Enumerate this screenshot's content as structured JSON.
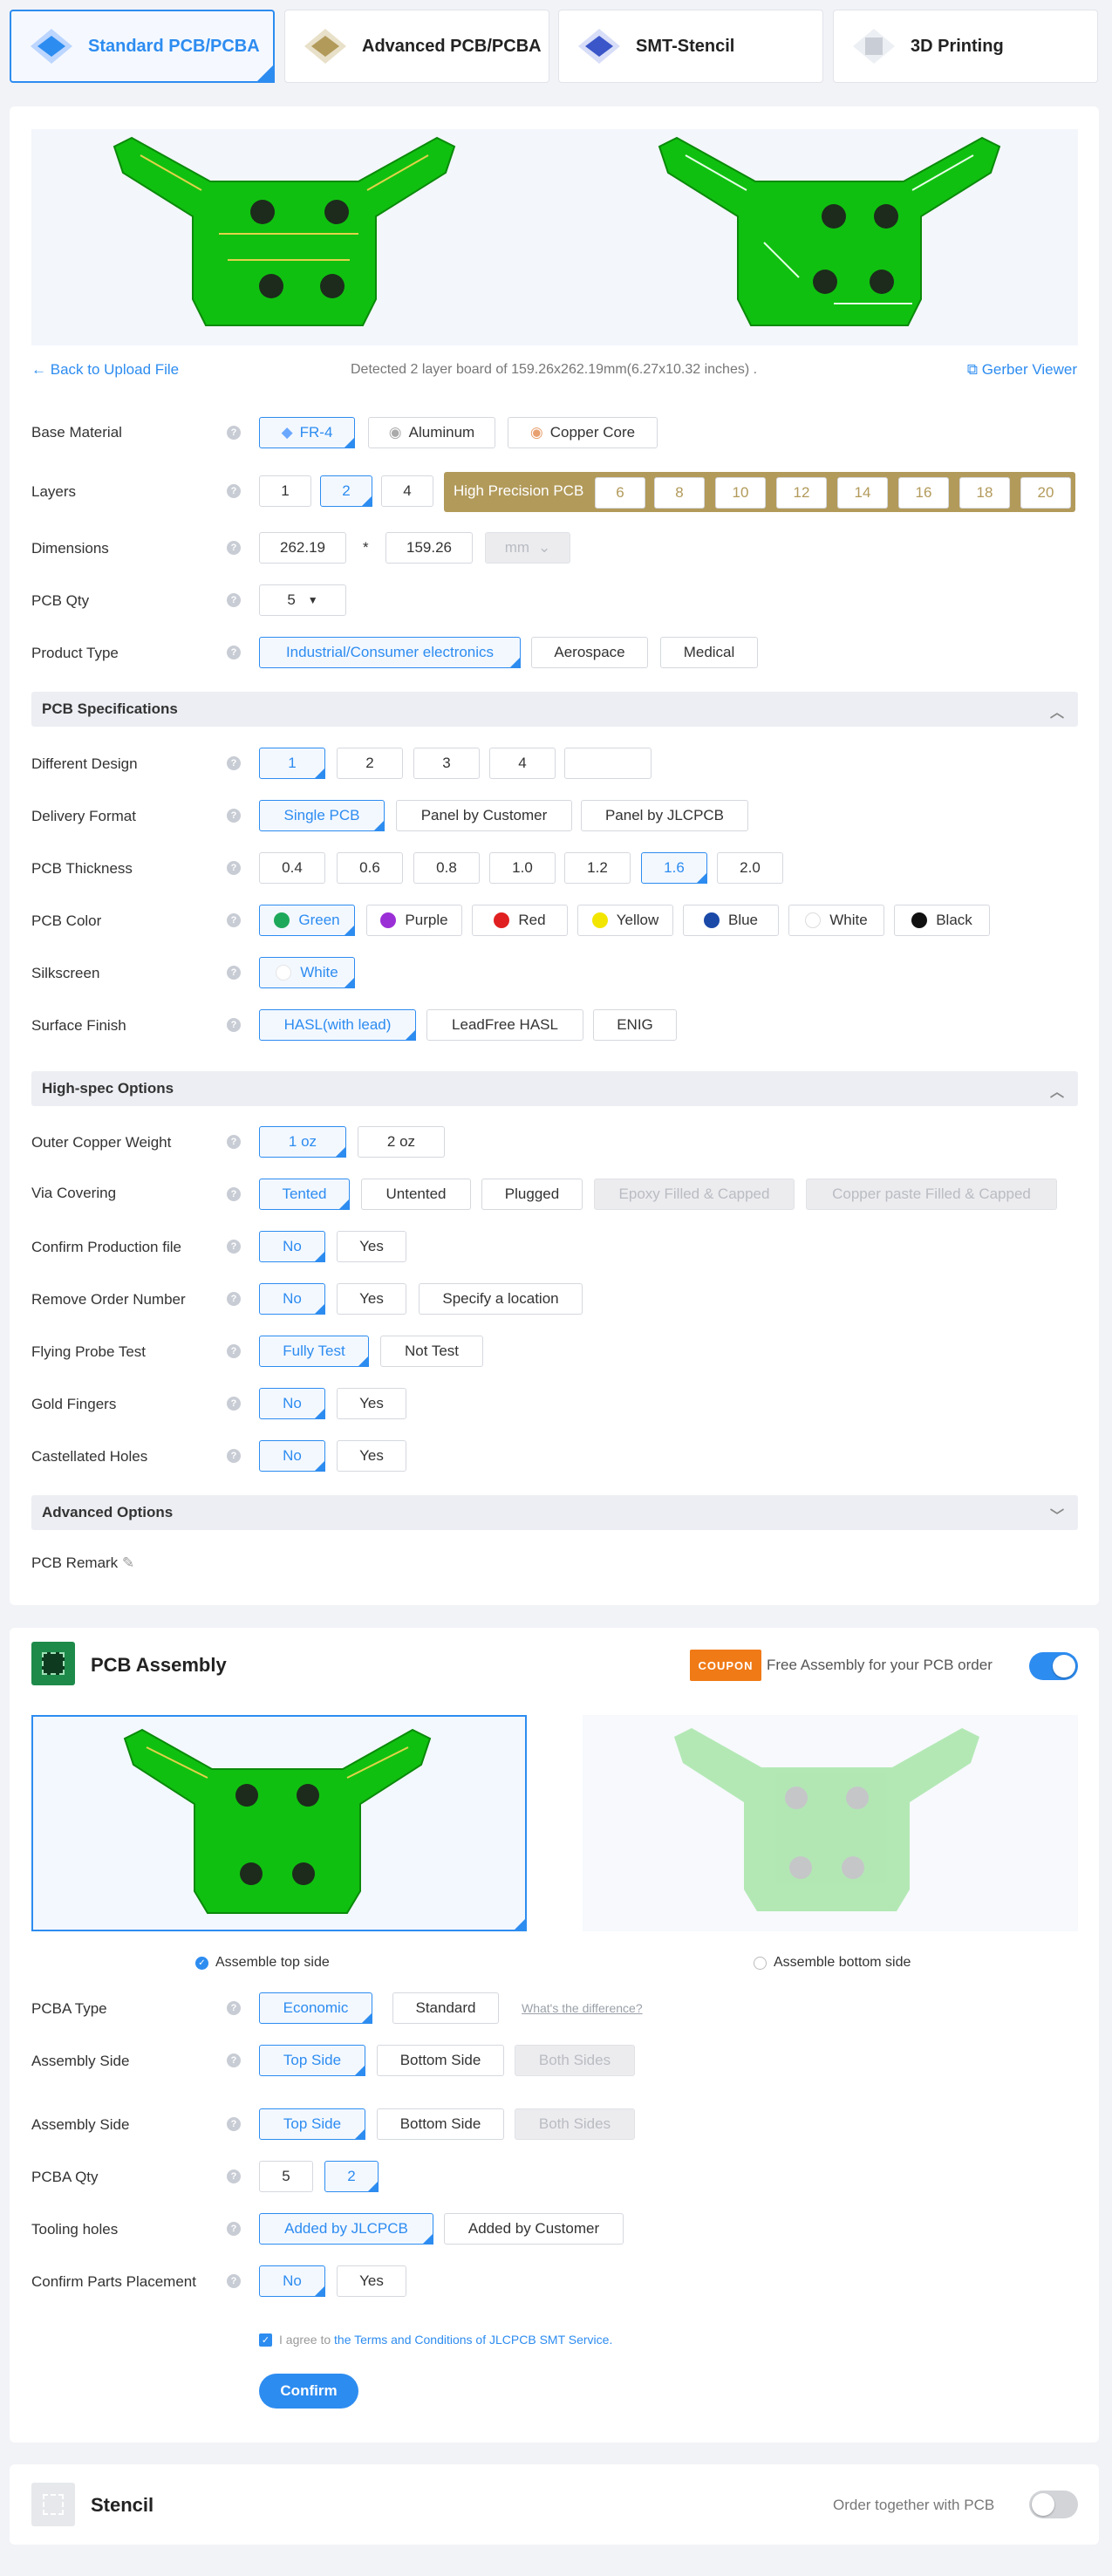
{
  "tabs": [
    {
      "label": "Standard PCB/PCBA"
    },
    {
      "label": "Advanced PCB/PCBA"
    },
    {
      "label": "SMT-Stencil"
    },
    {
      "label": "3D Printing"
    }
  ],
  "upload": {
    "back_label": "Back to Upload File",
    "detected_text": "Detected 2 layer board of 159.26x262.19mm(6.27x10.32 inches) .",
    "gerber_label": "Gerber Viewer"
  },
  "rows": {
    "base_material": {
      "label": "Base Material",
      "options": [
        "FR-4",
        "Aluminum",
        "Copper Core"
      ]
    },
    "layers": {
      "label": "Layers",
      "options": [
        "1",
        "2",
        "4"
      ],
      "hp_label": "High Precision PCB",
      "hp_options": [
        "6",
        "8",
        "10",
        "12",
        "14",
        "16",
        "18",
        "20"
      ]
    },
    "dimensions": {
      "label": "Dimensions",
      "length": "262.19",
      "width": "159.26",
      "sep": "*",
      "unit": "mm"
    },
    "pcb_qty": {
      "label": "PCB Qty",
      "value": "5"
    },
    "product_type": {
      "label": "Product Type",
      "options": [
        "Industrial/Consumer electronics",
        "Aerospace",
        "Medical"
      ]
    }
  },
  "specs": {
    "title": "PCB Specifications",
    "different_design": {
      "label": "Different Design",
      "options": [
        "1",
        "2",
        "3",
        "4",
        ""
      ]
    },
    "delivery_format": {
      "label": "Delivery Format",
      "options": [
        "Single PCB",
        "Panel by Customer",
        "Panel by JLCPCB"
      ]
    },
    "thickness": {
      "label": "PCB Thickness",
      "options": [
        "0.4",
        "0.6",
        "0.8",
        "1.0",
        "1.2",
        "1.6",
        "2.0"
      ]
    },
    "color": {
      "label": "PCB Color",
      "options": [
        "Green",
        "Purple",
        "Red",
        "Yellow",
        "Blue",
        "White",
        "Black"
      ],
      "dots": [
        "#1ea85a",
        "#9b2fd6",
        "#e02020",
        "#f2e600",
        "#1a49a8",
        "#ffffff",
        "#111111"
      ]
    },
    "silkscreen": {
      "label": "Silkscreen",
      "value": "White"
    },
    "surface_finish": {
      "label": "Surface Finish",
      "options": [
        "HASL(with lead)",
        "LeadFree HASL",
        "ENIG"
      ]
    }
  },
  "highspec": {
    "title": "High-spec Options",
    "copper": {
      "label": "Outer Copper Weight",
      "options": [
        "1 oz",
        "2 oz"
      ]
    },
    "via": {
      "label": "Via Covering",
      "options": [
        "Tented",
        "Untented",
        "Plugged",
        "Epoxy Filled & Capped",
        "Copper paste Filled & Capped"
      ]
    },
    "confirm_file": {
      "label": "Confirm Production file",
      "options": [
        "No",
        "Yes"
      ]
    },
    "remove_order": {
      "label": "Remove Order Number",
      "options": [
        "No",
        "Yes",
        "Specify a location"
      ]
    },
    "flying_probe": {
      "label": "Flying Probe Test",
      "options": [
        "Fully Test",
        "Not Test"
      ]
    },
    "gold_fingers": {
      "label": "Gold Fingers",
      "options": [
        "No",
        "Yes"
      ]
    },
    "castellated": {
      "label": "Castellated Holes",
      "options": [
        "No",
        "Yes"
      ]
    }
  },
  "advanced": {
    "title": "Advanced Options",
    "remark_label": "PCB Remark"
  },
  "assembly": {
    "title": "PCB Assembly",
    "coupon_text": "COUPON",
    "promo_text": "Free Assembly for your PCB order",
    "top_side_label": "Assemble top side",
    "bottom_side_label": "Assemble bottom side",
    "pcba_type": {
      "label": "PCBA Type",
      "options": [
        "Economic",
        "Standard"
      ],
      "link": "What's the difference?"
    },
    "assembly_side_1": {
      "label": "Assembly Side",
      "options": [
        "Top Side",
        "Bottom Side",
        "Both Sides"
      ]
    },
    "assembly_side_2": {
      "label": "Assembly Side",
      "options": [
        "Top Side",
        "Bottom Side",
        "Both Sides"
      ]
    },
    "pcba_qty": {
      "label": "PCBA Qty",
      "options": [
        "5",
        "2"
      ]
    },
    "tooling": {
      "label": "Tooling holes",
      "options": [
        "Added by JLCPCB",
        "Added by Customer"
      ]
    },
    "confirm_parts": {
      "label": "Confirm Parts Placement",
      "options": [
        "No",
        "Yes"
      ]
    },
    "agree_prefix": "I agree to",
    "agree_link": "the Terms and Conditions of JLCPCB SMT Service.",
    "confirm_button": "Confirm"
  },
  "stencil": {
    "title": "Stencil",
    "order_label": "Order together with PCB"
  },
  "help_glyph": "?",
  "colors": {
    "accent": "#2d8cf0",
    "pcb_green": "#10c010",
    "gold": "#b29a5a",
    "coupon": "#f07a16"
  }
}
